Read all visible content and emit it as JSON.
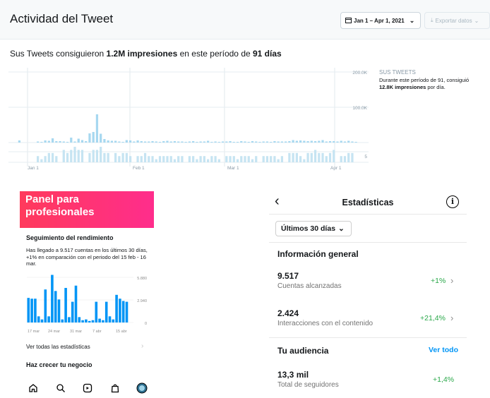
{
  "twitter": {
    "title": "Actividad del Tweet",
    "date_range": "Jan 1 – Apr 1, 2021",
    "export_label": "Exportar datos",
    "summary": {
      "prefix": "Sus Tweets consiguieron ",
      "impressions": "1.2M impresiones",
      "middle": " en este período de ",
      "days": "91 días"
    },
    "sidebar_title": "SUS TWEETS",
    "sidebar_text_1": "Durante este período de 91, consiguió",
    "sidebar_text_bold": "12.8K impresiones",
    "sidebar_text_2": " por día."
  },
  "chart_data": [
    {
      "type": "bar",
      "title": "",
      "ylim": [
        0,
        200000
      ],
      "ytick_labels": [
        "200.0K",
        "100.0K"
      ],
      "secondary_tick_label": "5",
      "xtick_labels": [
        "Jan 1",
        "Feb 1",
        "Mar 1",
        "Apr 1"
      ],
      "series": [
        {
          "values": [
            6000,
            0,
            0,
            0,
            0,
            3000,
            2000,
            6000,
            5000,
            12000,
            4000,
            4000,
            3000,
            2000,
            14000,
            3000,
            11000,
            7000,
            4000,
            26000,
            30000,
            80000,
            25000,
            10000,
            6000,
            5000,
            5000,
            3000,
            2000,
            7000,
            6000,
            3000,
            6000,
            4000,
            3000,
            3000,
            4000,
            3000,
            2000,
            4000,
            5000,
            3000,
            4000,
            3000,
            3000,
            2000,
            3000,
            4000,
            2000,
            3000,
            3000,
            5000,
            2000,
            3000,
            2000,
            3000,
            3000,
            4000,
            2000,
            2000,
            4000,
            3000,
            2000,
            4000,
            3000,
            2000,
            3000,
            3000,
            2000,
            4000,
            3000,
            3000,
            3000,
            4000,
            7000,
            5000,
            6000,
            5000,
            4000,
            5000,
            4000,
            5000,
            7000,
            3000,
            4000,
            4000,
            3000,
            5000,
            3000,
            5000,
            3000,
            2000
          ]
        },
        {
          "values": [
            0,
            0,
            0,
            0,
            0,
            2,
            1,
            2,
            3,
            3,
            2,
            0,
            4,
            3,
            4,
            5,
            4,
            4,
            0,
            3,
            4,
            4,
            5,
            3,
            3,
            0,
            3,
            2,
            3,
            3,
            2,
            0,
            2,
            2,
            3,
            2,
            2,
            1,
            2,
            2,
            2,
            2,
            1,
            2,
            2,
            0,
            2,
            2,
            1,
            2,
            2,
            1,
            2,
            2,
            1,
            0,
            2,
            2,
            2,
            1,
            2,
            2,
            2,
            1,
            2,
            0,
            2,
            2,
            2,
            2,
            1,
            2,
            0,
            3,
            3,
            3,
            2,
            1,
            3,
            3,
            4,
            3,
            3,
            2,
            3,
            4,
            0,
            2,
            2,
            3,
            3
          ]
        }
      ]
    },
    {
      "type": "bar",
      "ylim": [
        0,
        5880
      ],
      "ytick_labels": [
        "5.880",
        "2.940",
        "0"
      ],
      "xtick_labels": [
        "17 mar",
        "24 mar",
        "31 mar",
        "7 abr",
        "15 abr"
      ],
      "series": [
        {
          "values": [
            3200,
            3100,
            3100,
            800,
            400,
            4300,
            800,
            6200,
            4100,
            3000,
            400,
            4500,
            700,
            2700,
            4800,
            700,
            300,
            400,
            200,
            300,
            2700,
            500,
            300,
            2700,
            800,
            400,
            3600,
            3100,
            2800,
            2700
          ]
        }
      ]
    }
  ],
  "ig_pro": {
    "banner_title": "Panel para profesionales",
    "section_title": "Seguimiento del rendimiento",
    "description": "Has llegado a 9.517 cuentas en los últimos 30 días, +1% en comparación con el periodo del 15 feb - 16 mar.",
    "see_all": "Ver todas las estadísticas",
    "grow": "Haz crecer tu negocio",
    "accent_color": "#0095f6"
  },
  "stats": {
    "title": "Estadísticas",
    "period": "Últimos 30 días",
    "overview": "Información general",
    "rows": [
      {
        "value": "9.517",
        "label": "Cuentas alcanzadas",
        "change": "+1%"
      },
      {
        "value": "2.424",
        "label": "Interacciones con el contenido",
        "change": "+21,4%"
      }
    ],
    "audience": "Tu audiencia",
    "see_all": "Ver todo",
    "followers_value": "13,3 mil",
    "followers_label": "Total de seguidores",
    "followers_change": "+1,4%"
  }
}
